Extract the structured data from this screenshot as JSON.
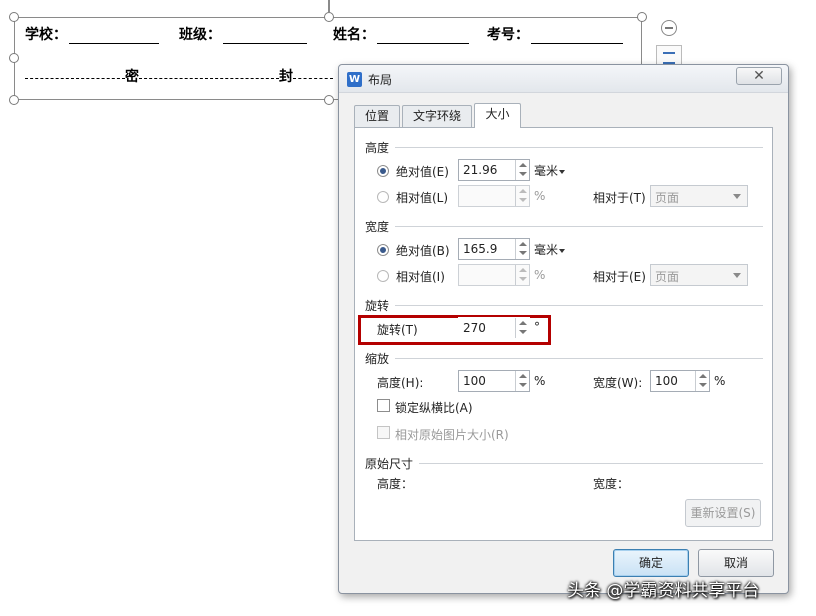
{
  "document": {
    "fields": [
      {
        "label": "学校："
      },
      {
        "label": "班级："
      },
      {
        "label": "姓名："
      },
      {
        "label": "考号："
      }
    ],
    "seal": {
      "mi": "密",
      "feng": "封"
    }
  },
  "dialog": {
    "title": "布局",
    "app_icon_letter": "W",
    "close_symbol": "✕",
    "tabs": [
      {
        "label": "位置",
        "active": false
      },
      {
        "label": "文字环绕",
        "active": false
      },
      {
        "label": "大小",
        "active": true
      }
    ],
    "height": {
      "title": "高度",
      "absolute_label": "绝对值(E)",
      "absolute_value": "21.96",
      "unit": "毫米",
      "relative_label": "相对值(L)",
      "relative_value": "",
      "percent": "%",
      "relative_to_label": "相对于(T)",
      "relative_to_value": "页面"
    },
    "width": {
      "title": "宽度",
      "absolute_label": "绝对值(B)",
      "absolute_value": "165.9",
      "unit": "毫米",
      "relative_label": "相对值(I)",
      "relative_value": "",
      "percent": "%",
      "relative_to_label": "相对于(E)",
      "relative_to_value": "页面"
    },
    "rotation": {
      "title": "旋转",
      "label": "旋转(T)",
      "value": "270",
      "unit": "°"
    },
    "scale": {
      "title": "缩放",
      "height_label": "高度(H):",
      "height_value": "100",
      "width_label": "宽度(W):",
      "width_value": "100",
      "percent": "%",
      "lock_aspect_label": "锁定纵横比(A)",
      "lock_aspect_checked": false,
      "relative_original_label": "相对原始图片大小(R)",
      "relative_original_checked": false
    },
    "original_size": {
      "title": "原始尺寸",
      "height_label": "高度：",
      "width_label": "宽度："
    },
    "reset_label": "重新设置(S)",
    "ok_label": "确定",
    "cancel_label": "取消"
  },
  "watermark": "头条 @学霸资料共享平台",
  "colors": {
    "highlight": "#b40000",
    "accent": "#2f6fc9"
  }
}
